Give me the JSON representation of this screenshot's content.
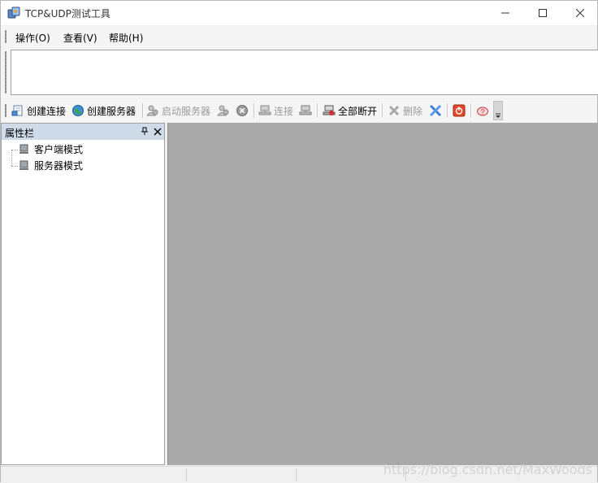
{
  "window": {
    "title": "TCP&UDP测试工具"
  },
  "menu": [
    {
      "label": "操作(O)"
    },
    {
      "label": "查看(V)"
    },
    {
      "label": "帮助(H)"
    }
  ],
  "toolbar": {
    "create_connection": "创建连接",
    "create_server": "创建服务器",
    "start_server": "启动服务器",
    "connect": "连接",
    "disconnect_all": "全部断开",
    "delete": "删除"
  },
  "panel": {
    "title": "属性栏",
    "items": [
      {
        "label": "客户端模式"
      },
      {
        "label": "服务器模式"
      }
    ]
  },
  "watermark": "https://blog.csdn.net/MaxWoods",
  "colors": {
    "content_bg": "#a9a9a9",
    "panel_header": "#cfdbe9",
    "disabled_text": "#9a9a9a"
  }
}
